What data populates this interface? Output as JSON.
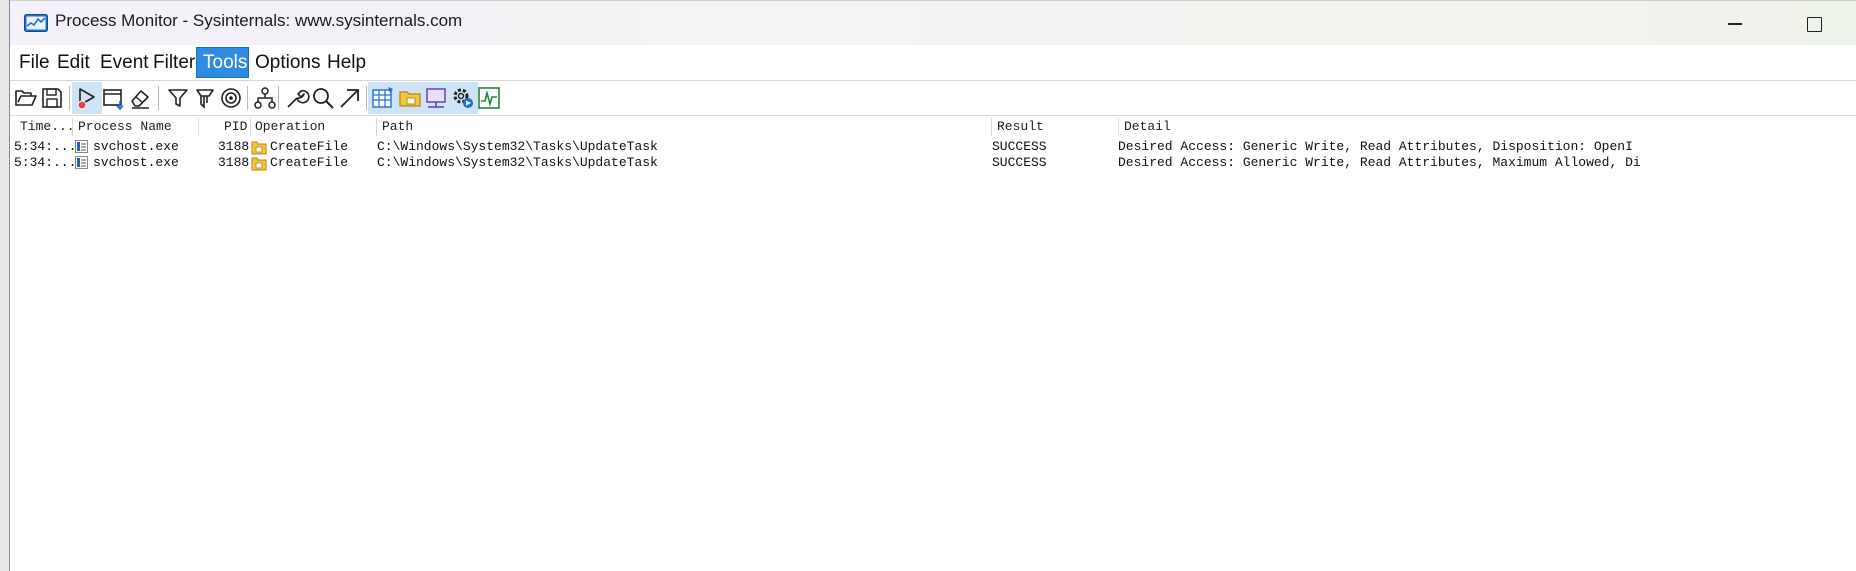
{
  "window": {
    "title": "Process Monitor - Sysinternals: www.sysinternals.com"
  },
  "menu": [
    "File",
    "Edit",
    "Event",
    "Filter",
    "Tools",
    "Options",
    "Help"
  ],
  "menu_active": "Tools",
  "toolbar_icons": [
    "open-folder-icon",
    "save-icon",
    "capture-icon",
    "autoscroll-icon",
    "clear-icon",
    "filter-icon",
    "highlight-icon",
    "target-icon",
    "process-tree-icon",
    "properties-wrench-icon",
    "find-icon",
    "jump-to-icon",
    "registry-activity-icon",
    "file-activity-icon",
    "network-activity-icon",
    "process-activity-icon",
    "profiling-activity-icon"
  ],
  "columns": [
    "Time...",
    "Process Name",
    "PID",
    "Operation",
    "Path",
    "Result",
    "Detail"
  ],
  "rows": [
    {
      "time": "5:34:...",
      "process": "svchost.exe",
      "pid": "3188",
      "operation": "CreateFile",
      "path": "C:\\Windows\\System32\\Tasks\\UpdateTask",
      "result": "SUCCESS",
      "detail": "Desired Access: Generic Write, Read Attributes, Disposition: OpenI"
    },
    {
      "time": "5:34:...",
      "process": "svchost.exe",
      "pid": "3188",
      "operation": "CreateFile",
      "path": "C:\\Windows\\System32\\Tasks\\UpdateTask",
      "result": "SUCCESS",
      "detail": "Desired Access: Generic Write, Read Attributes, Maximum Allowed, Di"
    }
  ],
  "colors": {
    "menu_active_bg": "#2e8de0",
    "operation_icon": "#d9a21b",
    "process_icon": "#2a5fb0"
  }
}
